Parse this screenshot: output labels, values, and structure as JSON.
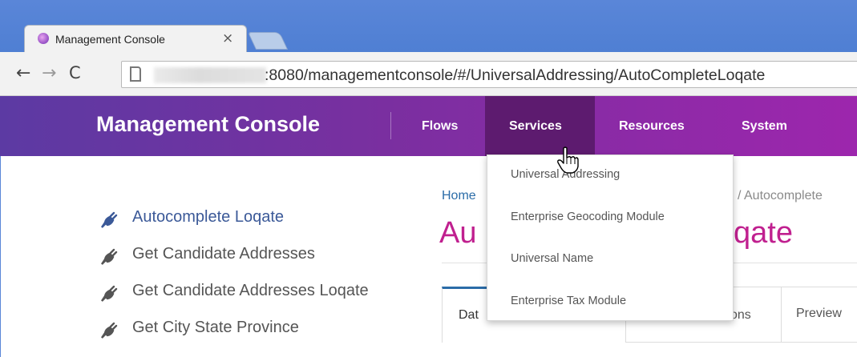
{
  "browser": {
    "tab_title": "Management Console",
    "tab_close": "×",
    "url": ":8080/managementconsole/#/UniversalAddressing/AutoCompleteLoqate",
    "back": "←",
    "forward": "→",
    "reload": "C"
  },
  "header": {
    "brand": "Management Console",
    "nav": [
      "Flows",
      "Services",
      "Resources",
      "System"
    ],
    "active_nav": "Services"
  },
  "sidebar": {
    "items": [
      {
        "label": "Autocomplete Loqate",
        "active": true,
        "icon": "plug-icon"
      },
      {
        "label": "Get Candidate Addresses",
        "active": false,
        "icon": "plug-icon"
      },
      {
        "label": "Get Candidate Addresses Loqate",
        "active": false,
        "icon": "plug-icon"
      },
      {
        "label": "Get City State Province",
        "active": false,
        "icon": "plug-icon"
      }
    ]
  },
  "main": {
    "breadcrumb_home": "Home",
    "breadcrumb_current": "/  Autocomplete",
    "heading_left": "Au",
    "heading_right": "qate",
    "tabs": [
      "Dat",
      "ons",
      "Preview"
    ]
  },
  "dropdown": {
    "items": [
      "Universal Addressing",
      "Enterprise Geocoding Module",
      "Universal Name",
      "Enterprise Tax Module"
    ]
  },
  "colors": {
    "header_start": "#5c3aa3",
    "header_end": "#9d26ad",
    "nav_active": "#5d1b6f",
    "heading_magenta": "#c0208f",
    "link_blue": "#2b6ca8"
  }
}
